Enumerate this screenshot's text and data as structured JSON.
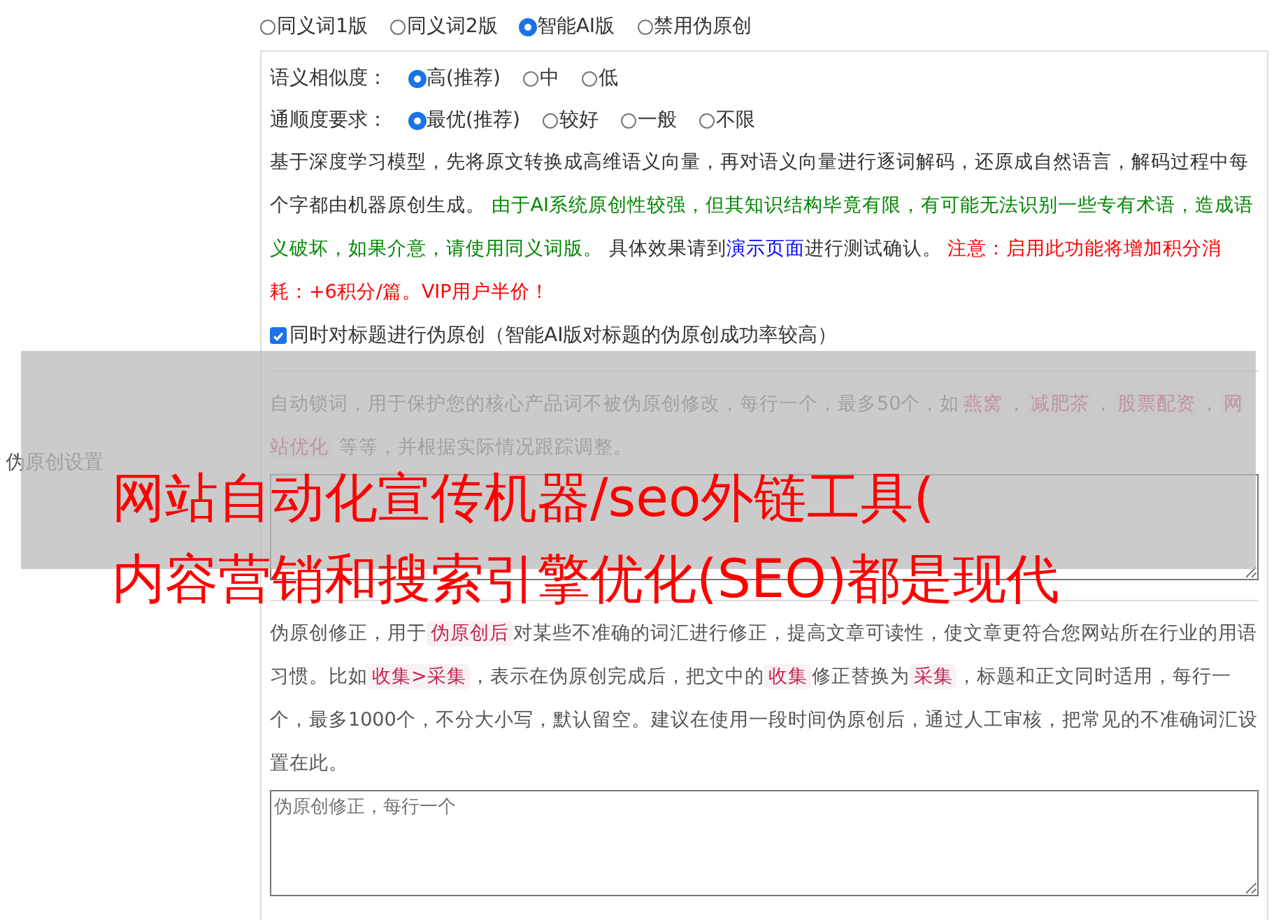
{
  "section_label": "伪原创设置",
  "modes": [
    {
      "label": "同义词1版",
      "selected": false
    },
    {
      "label": "同义词2版",
      "selected": false
    },
    {
      "label": "智能AI版",
      "selected": true
    },
    {
      "label": "禁用伪原创",
      "selected": false
    }
  ],
  "similarity": {
    "label": "语义相似度：",
    "options": [
      {
        "label": "高(推荐)",
        "selected": true
      },
      {
        "label": "中",
        "selected": false
      },
      {
        "label": "低",
        "selected": false
      }
    ]
  },
  "fluency": {
    "label": "通顺度要求：",
    "options": [
      {
        "label": "最优(推荐)",
        "selected": true
      },
      {
        "label": "较好",
        "selected": false
      },
      {
        "label": "一般",
        "selected": false
      },
      {
        "label": "不限",
        "selected": false
      }
    ]
  },
  "ai_description": [
    {
      "kind": "normal",
      "text": "基于深度学习模型，先将原文转换成高维语义向量，再对语义向量进行逐词解码，还原成自然语言，解码过程中每个字都由机器原创生成。 "
    },
    {
      "kind": "green",
      "text": "由于AI系统原创性较强，但其知识结构毕竟有限，有可能无法识别一些专有术语，造成语义破坏，如果介意，请使用同义词版。"
    },
    {
      "kind": "normal",
      "text": " 具体效果请到"
    },
    {
      "kind": "link",
      "text": "演示页面"
    },
    {
      "kind": "normal",
      "text": "进行测试确认。 "
    },
    {
      "kind": "red",
      "text": "注意：启用此功能将增加积分消耗：+6积分/篇。VIP用户半价！"
    }
  ],
  "title_option": {
    "label": "同时对标题进行伪原创（智能AI版对标题的伪原创成功率较高）",
    "checked": true
  },
  "lock_words": {
    "description": [
      {
        "kind": "text",
        "text": "自动锁词，用于保护您的核心产品词不被伪原创修改，每行一个，最多50个，如"
      },
      {
        "kind": "tag",
        "text": "燕窝"
      },
      {
        "kind": "text",
        "text": "，"
      },
      {
        "kind": "tag",
        "text": "减肥茶"
      },
      {
        "kind": "text",
        "text": "，"
      },
      {
        "kind": "tag",
        "text": "股票配资"
      },
      {
        "kind": "text",
        "text": "，"
      },
      {
        "kind": "tag",
        "text": "网站优化"
      },
      {
        "kind": "text",
        "text": " 等等，并根据实际情况跟踪调整。"
      }
    ]
  },
  "corrections": {
    "description": [
      {
        "kind": "text",
        "text": "伪原创修正，用于"
      },
      {
        "kind": "tag",
        "text": "伪原创后"
      },
      {
        "kind": "text",
        "text": "对某些不准确的词汇进行修正，提高文章可读性，使文章更符合您网站所在行业的用语习惯。比如"
      },
      {
        "kind": "tag",
        "text": "收集>采集"
      },
      {
        "kind": "text",
        "text": "，表示在伪原创完成后，把文中的"
      },
      {
        "kind": "tag",
        "text": "收集"
      },
      {
        "kind": "text",
        "text": "修正替换为"
      },
      {
        "kind": "tag",
        "text": "采集"
      },
      {
        "kind": "text",
        "text": "，标题和正文同时适用，每行一个，最多1000个，不分大小写，默认留空。建议在使用一段时间伪原创后，通过人工审核，把常见的不准确词汇设置在此。"
      }
    ],
    "placeholder": "伪原创修正，每行一个"
  },
  "overlay_caption": [
    "网站自动化宣传机器/seo外链工具(",
    "内容营销和搜索引擎优化(SEO)都是现代"
  ]
}
